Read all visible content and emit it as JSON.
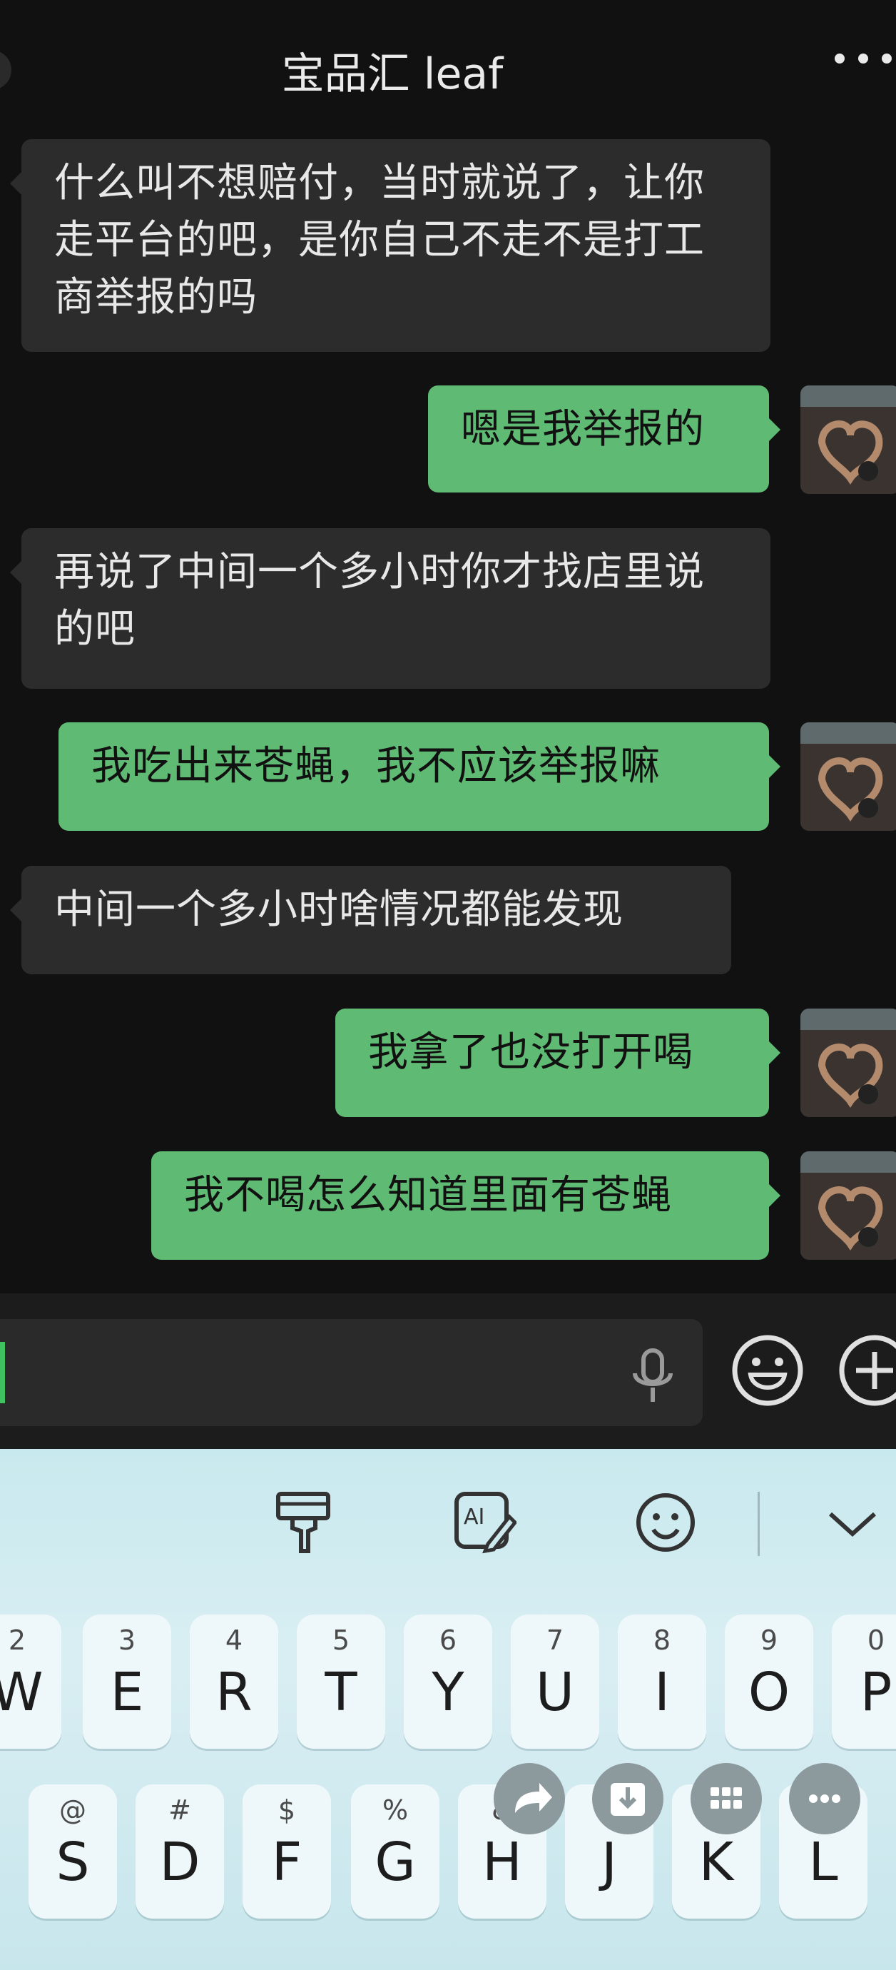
{
  "header": {
    "title": "宝品汇 leaf"
  },
  "messages": [
    {
      "side": "in",
      "text": "什么叫不想赔付，当时就说了，让你走平台的吧，是你自己不走不是打工商举报的吗"
    },
    {
      "side": "out",
      "text": "嗯是我举报的"
    },
    {
      "side": "in",
      "text": "再说了中间一个多小时你才找店里说的吧"
    },
    {
      "side": "out",
      "text": "我吃出来苍蝇，我不应该举报嘛"
    },
    {
      "side": "in",
      "text": "中间一个多小时啥情况都能发现"
    },
    {
      "side": "out",
      "text": "我拿了也没打开喝"
    },
    {
      "side": "out",
      "text": "我不喝怎么知道里面有苍蝇"
    }
  ],
  "keyboard": {
    "row1": [
      {
        "hint": "2",
        "key": "W"
      },
      {
        "hint": "3",
        "key": "E"
      },
      {
        "hint": "4",
        "key": "R"
      },
      {
        "hint": "5",
        "key": "T"
      },
      {
        "hint": "6",
        "key": "Y"
      },
      {
        "hint": "7",
        "key": "U"
      },
      {
        "hint": "8",
        "key": "I"
      },
      {
        "hint": "9",
        "key": "O"
      },
      {
        "hint": "0",
        "key": "P"
      }
    ],
    "row2": [
      {
        "hint": "@",
        "key": "S"
      },
      {
        "hint": "#",
        "key": "D"
      },
      {
        "hint": "$",
        "key": "F"
      },
      {
        "hint": "%",
        "key": "G"
      },
      {
        "hint": "&",
        "key": "H"
      },
      {
        "hint": "",
        "key": "J"
      },
      {
        "hint": "(",
        "key": "K"
      },
      {
        "hint": "",
        "key": "L"
      }
    ]
  },
  "icons": {
    "voice": "microphone-icon",
    "emoji": "emoji-icon",
    "plus": "plus-icon",
    "theme": "paint-brush-icon",
    "ai": "ai-write-icon",
    "kb_emoji": "smiley-icon",
    "collapse": "chevron-down-icon",
    "share": "share-icon",
    "save": "download-icon",
    "grid": "grid-icon",
    "more": "more-icon"
  },
  "colors": {
    "outgoing": "#5fba73",
    "incoming": "#2c2c2c",
    "background": "#111111",
    "keyboard": "#cde9ee"
  }
}
